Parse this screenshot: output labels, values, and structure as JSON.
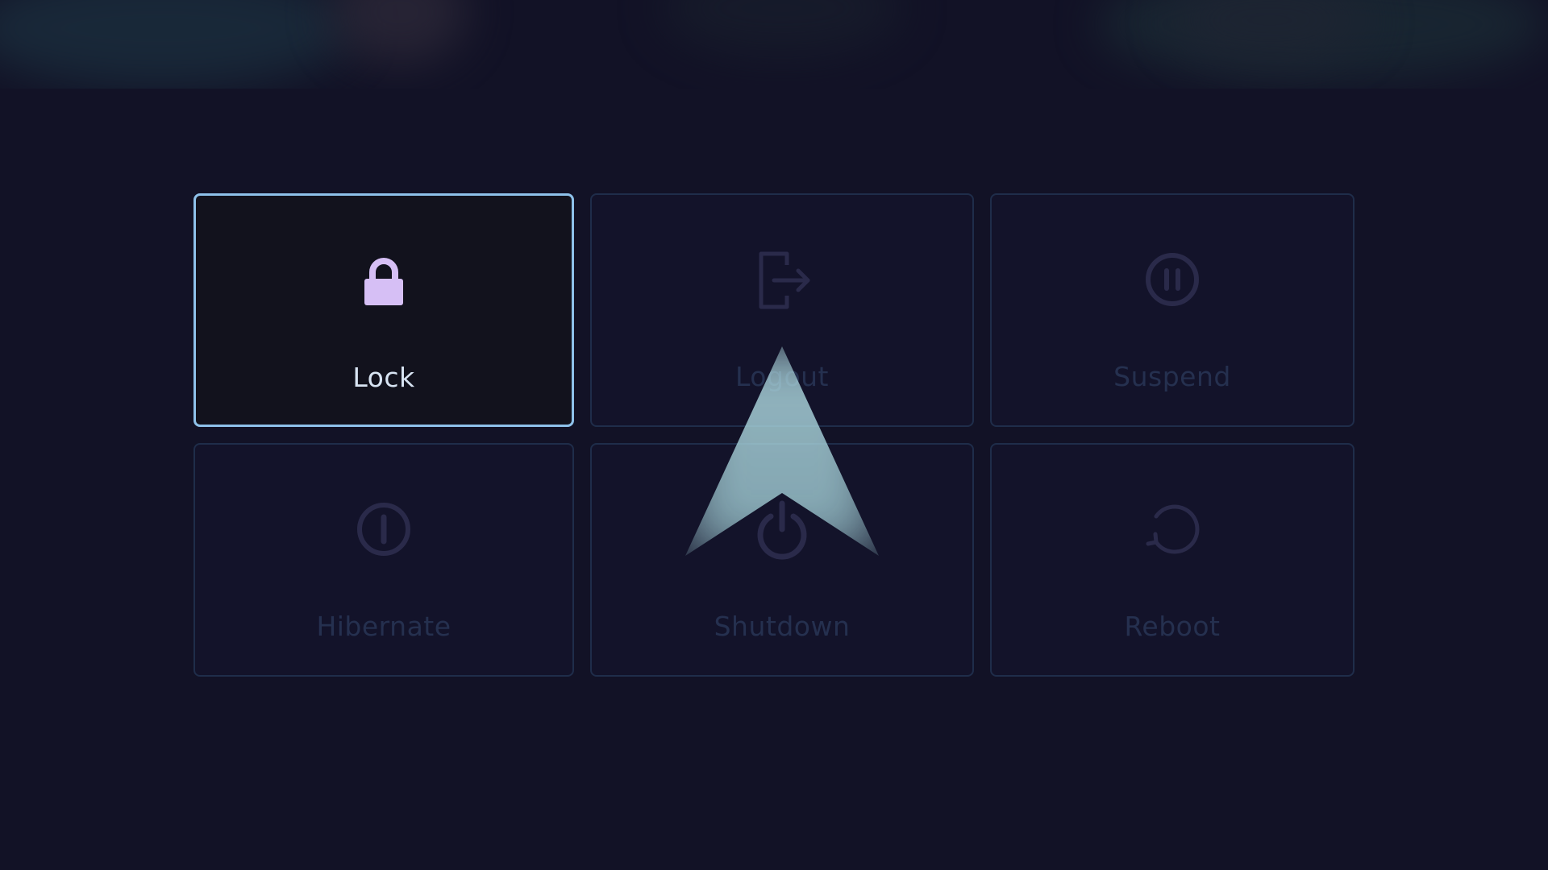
{
  "power_menu": {
    "options": [
      {
        "label": "Lock",
        "icon": "lock-icon",
        "selected": true
      },
      {
        "label": "Logout",
        "icon": "logout-icon",
        "selected": false
      },
      {
        "label": "Suspend",
        "icon": "pause-icon",
        "selected": false
      },
      {
        "label": "Hibernate",
        "icon": "hibernate-icon",
        "selected": false
      },
      {
        "label": "Shutdown",
        "icon": "power-icon",
        "selected": false
      },
      {
        "label": "Reboot",
        "icon": "reboot-icon",
        "selected": false
      }
    ]
  },
  "colors": {
    "background": "#121226",
    "tile_border": "#1f2d4a",
    "selected_border": "#8ec1ea",
    "selected_icon": "#d6bff5",
    "dim_icon": "#2a2a4a",
    "selected_text": "#d8e4f3",
    "dim_text": "#25304f"
  }
}
